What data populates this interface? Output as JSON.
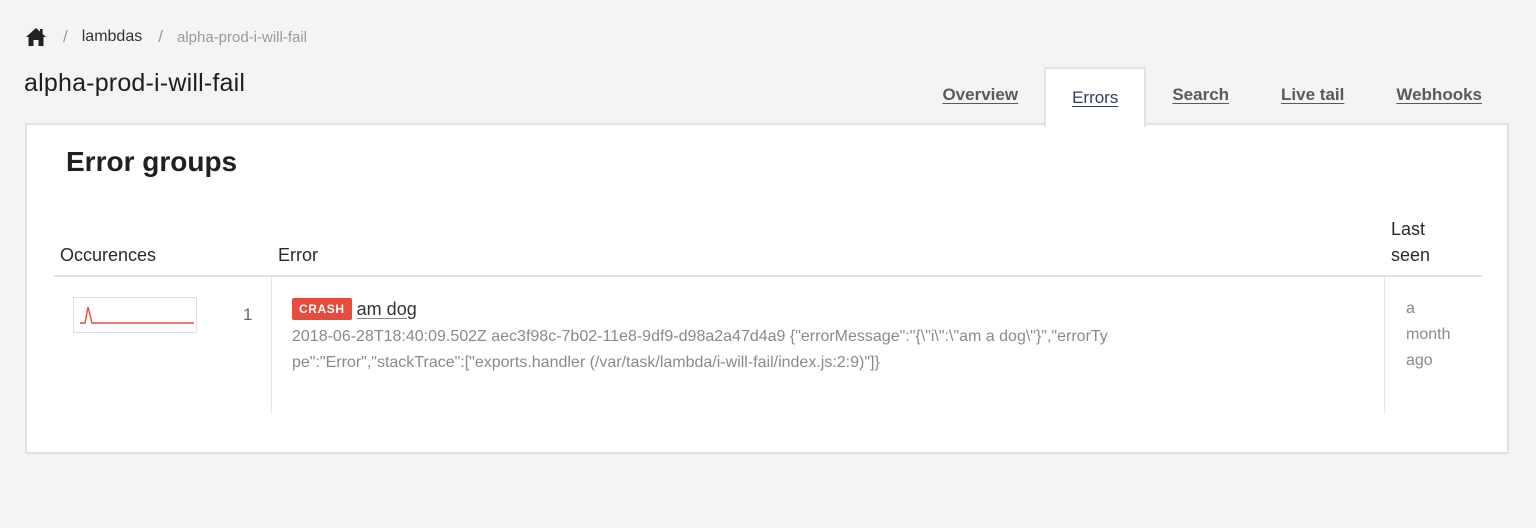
{
  "breadcrumb": {
    "home_icon": "home-icon",
    "items": [
      {
        "label": "lambdas"
      },
      {
        "label": "alpha-prod-i-will-fail"
      }
    ],
    "separator": "/"
  },
  "page_title": "alpha-prod-i-will-fail",
  "tabs": [
    {
      "label": "Overview",
      "active": false
    },
    {
      "label": "Errors",
      "active": true
    },
    {
      "label": "Search",
      "active": false
    },
    {
      "label": "Live tail",
      "active": false
    },
    {
      "label": "Webhooks",
      "active": false
    }
  ],
  "panel": {
    "title": "Error groups",
    "columns": {
      "occurrences": "Occurences",
      "error": "Error",
      "last_seen_line1": "Last",
      "last_seen_line2": "seen"
    },
    "rows": [
      {
        "count": "1",
        "badge": "CRASH",
        "title": "am dog",
        "detail": "2018-06-28T18:40:09.502Z aec3f98c-7b02-11e8-9df9-d98a2a47d4a9 {\"errorMessage\":\"{\\\"i\\\":\\\"am a dog\\\"}\",\"errorType\":\"Error\",\"stackTrace\":[\"exports.handler (/var/task/lambda/i-will-fail/index.js:2:9)\"]}",
        "last_seen_line1": "a",
        "last_seen_line2": "month",
        "last_seen_line3": "ago"
      }
    ]
  },
  "colors": {
    "badge_crash": "#e74c3c",
    "sparkline": "#e74c3c",
    "background": "#f4f4f4"
  }
}
